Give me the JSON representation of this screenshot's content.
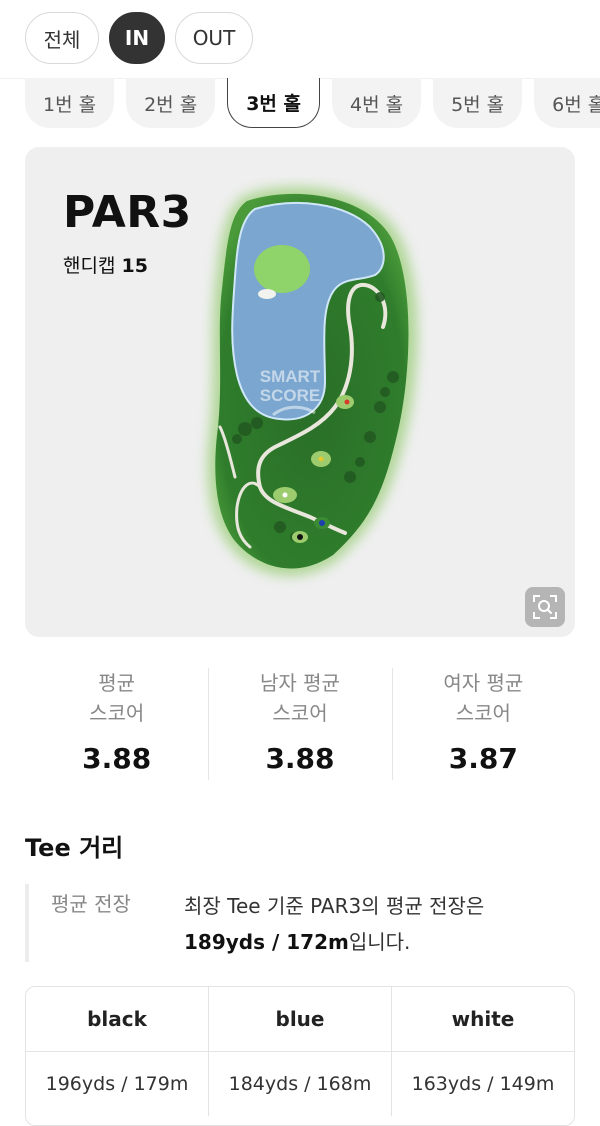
{
  "segments": [
    {
      "label": "전체",
      "active": false
    },
    {
      "label": "IN",
      "active": true
    },
    {
      "label": "OUT",
      "active": false
    }
  ],
  "holes": [
    "1번 홀",
    "2번 홀",
    "3번 홀",
    "4번 홀",
    "5번 홀",
    "6번 홀"
  ],
  "selected_hole_index": 2,
  "hole_info": {
    "par": "PAR3",
    "handicap_label": "핸디캡",
    "handicap_value": "15",
    "watermark_line1": "SMART",
    "watermark_line2": "SCORE"
  },
  "stats": [
    {
      "label1": "평균",
      "label2": "스코어",
      "value": "3.88"
    },
    {
      "label1": "남자 평균",
      "label2": "스코어",
      "value": "3.88"
    },
    {
      "label1": "여자 평균",
      "label2": "스코어",
      "value": "3.87"
    }
  ],
  "tee": {
    "title": "Tee 거리",
    "avg_label": "평균 전장",
    "desc_prefix": "최장 Tee 기준 PAR3의 평균 전장은",
    "desc_value": "189yds / 172m",
    "desc_suffix": "입니다.",
    "table": {
      "headers": [
        "black",
        "blue",
        "white"
      ],
      "rows": [
        [
          "196yds / 179m",
          "184yds / 168m",
          "163yds / 149m"
        ]
      ]
    }
  },
  "icons": {
    "zoom": "zoom-search-icon"
  },
  "colors": {
    "active_segment": "#333333",
    "water": "#7aa6cf",
    "rough": "#2f7d2c",
    "green": "#8fd46a",
    "tee_black": "#111111",
    "tee_blue": "#1e3fb0",
    "tee_white": "#ffffff",
    "pin_red": "#d83b2b"
  }
}
